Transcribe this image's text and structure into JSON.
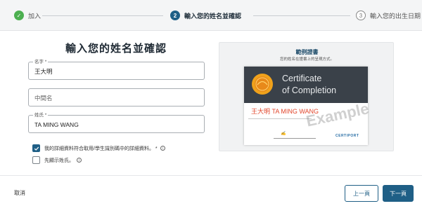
{
  "stepper": {
    "steps": [
      {
        "number": "✓",
        "label": "加入",
        "state": "done"
      },
      {
        "number": "2",
        "label": "輸入您的姓名並確認",
        "state": "active"
      },
      {
        "number": "3",
        "label": "輸入您的出生日期",
        "state": "todo"
      }
    ]
  },
  "form": {
    "title": "輸入您的姓名並確認",
    "first_name": {
      "label": "名字 *",
      "value": "王大明"
    },
    "middle_name": {
      "placeholder": "中間名",
      "value": ""
    },
    "last_name": {
      "label": "姓氏 *",
      "value": "TA MING WANG"
    },
    "checkbox_match": {
      "label": "我的詳細資料符合取用/學生識別碼中的詳細資料。 *",
      "checked": true
    },
    "checkbox_surname_first": {
      "label": "先顯示姓氏。",
      "checked": false
    }
  },
  "sample": {
    "title": "範例證書",
    "subtitle": "您的姓名在證書上的呈現方式。",
    "certificate": {
      "title_line1": "Certificate",
      "title_line2": "of Completion",
      "name": "王大明 TA MING WANG",
      "watermark": "Example",
      "brand": "CERTIPORT"
    }
  },
  "footer": {
    "cancel": "取消",
    "prev": "上一頁",
    "next": "下一頁"
  },
  "colors": {
    "accent": "#1f5f86",
    "success": "#4caf50",
    "cert_name": "#e2452b"
  }
}
